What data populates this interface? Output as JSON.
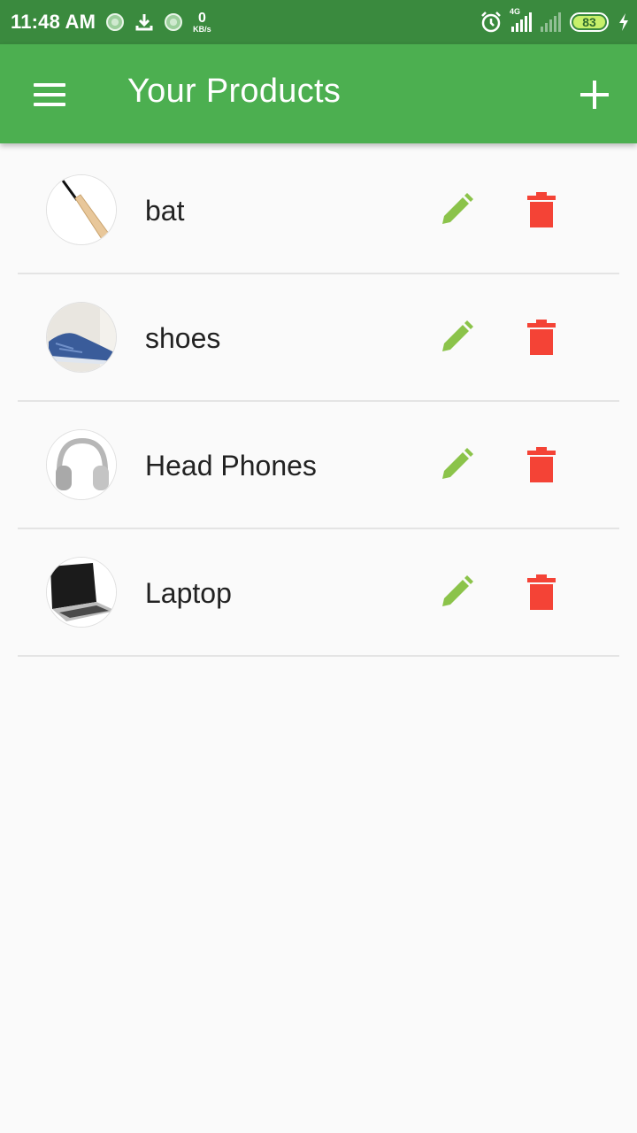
{
  "status_bar": {
    "time": "11:48 AM",
    "speed_value": "0",
    "speed_unit": "KB/s",
    "network_type": "4G",
    "battery": "83"
  },
  "app_bar": {
    "title": "Your Products"
  },
  "products": [
    {
      "name": "bat",
      "image": "cricket-bat"
    },
    {
      "name": "shoes",
      "image": "blue-sneaker"
    },
    {
      "name": "Head Phones",
      "image": "headphones"
    },
    {
      "name": "Laptop",
      "image": "laptop"
    }
  ],
  "colors": {
    "status_bar": "#3a8a3e",
    "app_bar": "#4caf50",
    "edit": "#8bc34a",
    "delete": "#f44336",
    "background": "#fafafa"
  }
}
